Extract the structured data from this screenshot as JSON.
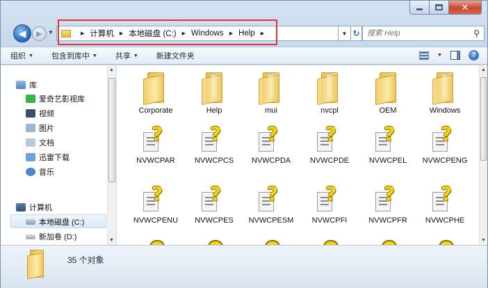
{
  "window": {
    "close_label": "✕"
  },
  "navigation": {
    "back_label": "◀",
    "forward_label": "▶",
    "breadcrumbs": [
      "计算机",
      "本地磁盘 (C:)",
      "Windows",
      "Help"
    ],
    "search_placeholder": "搜索 Help"
  },
  "toolbar": {
    "organize": "组织",
    "include_in_library": "包含到库中",
    "share": "共享",
    "new_folder": "新建文件夹"
  },
  "nav_pane": {
    "libraries": "库",
    "iqiyi": "爱奇艺影视库",
    "videos": "视频",
    "pictures": "图片",
    "documents": "文档",
    "xunlei": "迅雷下载",
    "music": "音乐",
    "computer": "计算机",
    "local_disk": "本地磁盘 (C:)",
    "new_volume": "新加卷 (D:)"
  },
  "items": [
    {
      "name": "Corporate",
      "type": "folder"
    },
    {
      "name": "Help",
      "type": "folder"
    },
    {
      "name": "mui",
      "type": "folder"
    },
    {
      "name": "nvcpl",
      "type": "folder"
    },
    {
      "name": "OEM",
      "type": "folder"
    },
    {
      "name": "Windows",
      "type": "folder"
    },
    {
      "name": "NVWCPAR",
      "type": "file"
    },
    {
      "name": "NVWCPCS",
      "type": "file"
    },
    {
      "name": "NVWCPDA",
      "type": "file"
    },
    {
      "name": "NVWCPDE",
      "type": "file"
    },
    {
      "name": "NVWCPEL",
      "type": "file"
    },
    {
      "name": "NVWCPENG",
      "type": "file"
    },
    {
      "name": "NVWCPENU",
      "type": "file"
    },
    {
      "name": "NVWCPES",
      "type": "file"
    },
    {
      "name": "NVWCPESM",
      "type": "file"
    },
    {
      "name": "NVWCPFI",
      "type": "file"
    },
    {
      "name": "NVWCPFR",
      "type": "file"
    },
    {
      "name": "NVWCPHE",
      "type": "file"
    }
  ],
  "status": {
    "count": "35 个对象"
  },
  "colors": {
    "highlight_box": "#e8332f",
    "folder": "#f3cf6b",
    "help_icon": "#f1d414"
  }
}
